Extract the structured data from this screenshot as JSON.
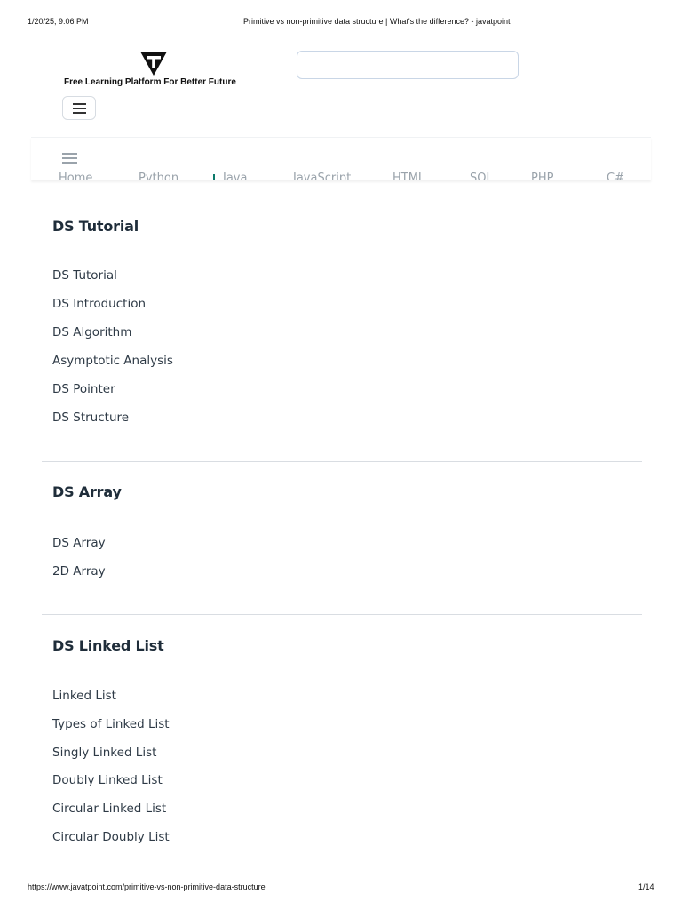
{
  "print_header": {
    "datetime": "1/20/25, 9:06 PM",
    "page_title": "Primitive vs non-primitive data structure | What's the difference? - javatpoint"
  },
  "site": {
    "tagline": "Free Learning Platform For Better Future",
    "search_value": "",
    "logo_icon": "javatpoint-t-logo",
    "menu_icon": "hamburger-icon"
  },
  "nav": {
    "links": [
      "Home",
      "Python",
      "Java",
      "JavaScript",
      "HTML",
      "SQL",
      "PHP",
      "C#"
    ],
    "active_color": "#0c7a6b"
  },
  "sections": [
    {
      "title": "DS Tutorial",
      "items": [
        "DS Tutorial",
        "DS Introduction",
        "DS Algorithm",
        "Asymptotic Analysis",
        "DS Pointer",
        "DS Structure"
      ]
    },
    {
      "title": "DS Array",
      "items": [
        "DS Array",
        "2D Array"
      ]
    },
    {
      "title": "DS Linked List",
      "items": [
        "Linked List",
        "Types of Linked List",
        "Singly Linked List",
        "Doubly Linked List",
        "Circular Linked List",
        "Circular Doubly List"
      ]
    }
  ],
  "print_footer": {
    "url": "https://www.javatpoint.com/primitive-vs-non-primitive-data-structure",
    "page": "1/14"
  }
}
